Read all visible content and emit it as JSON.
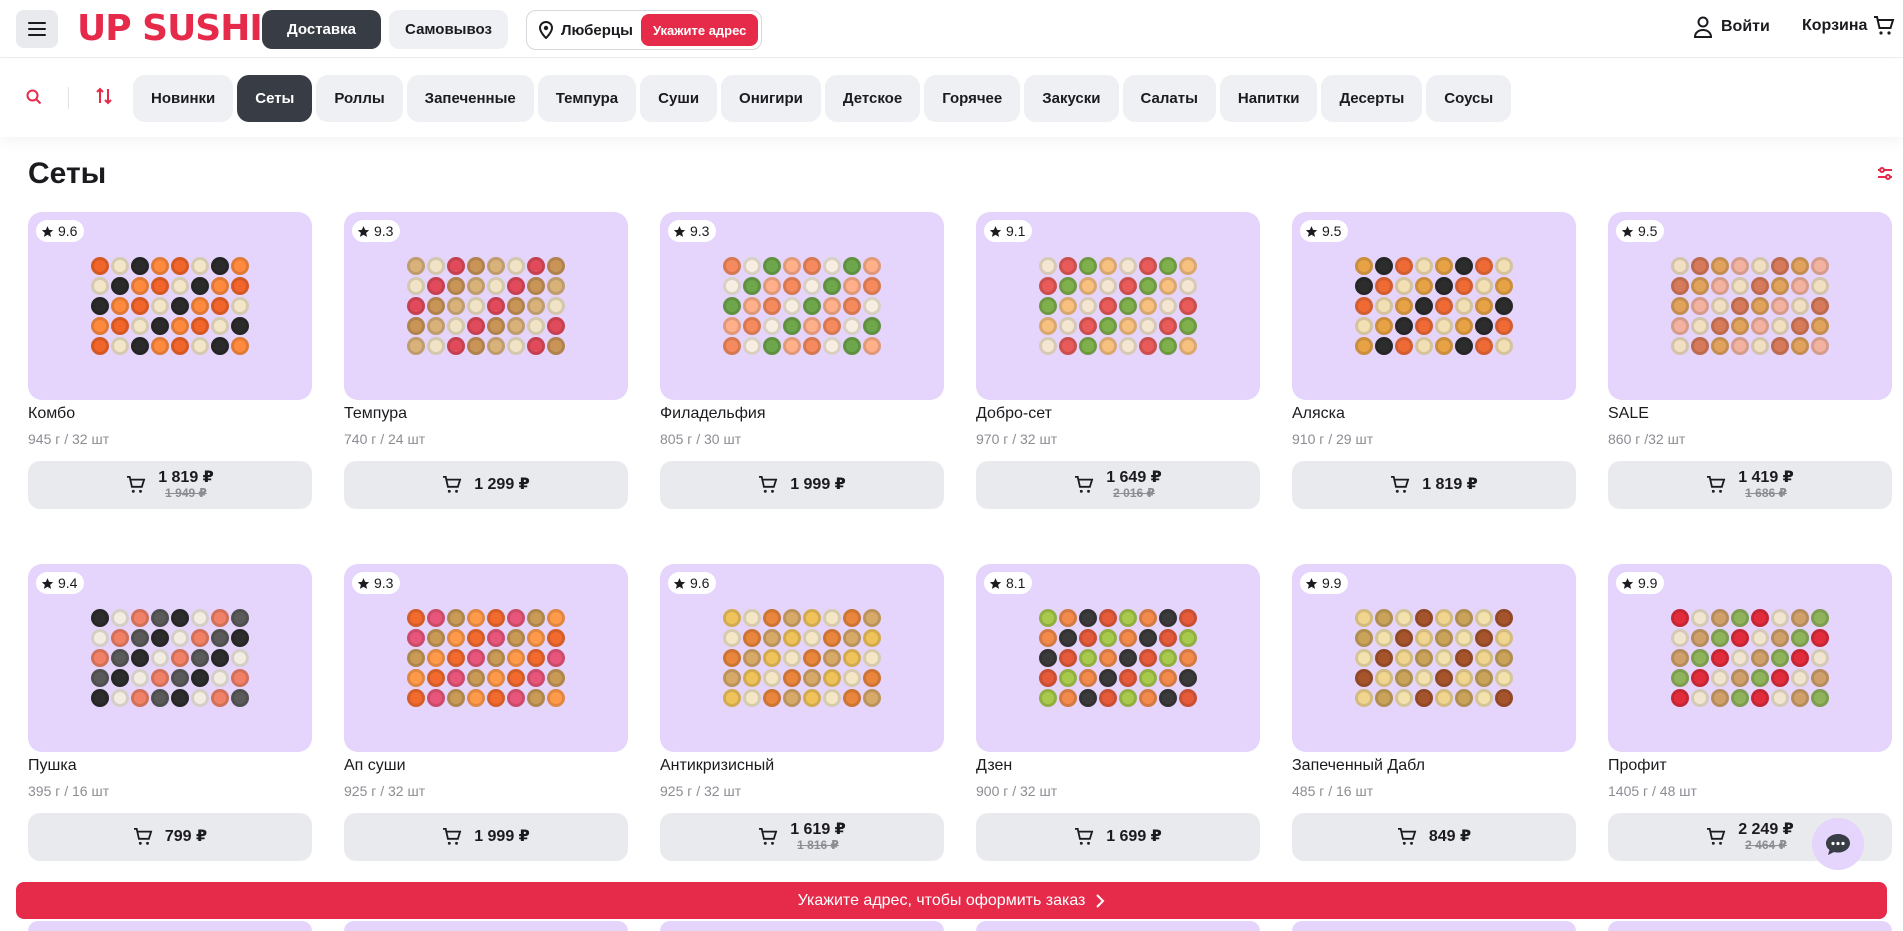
{
  "header": {
    "logo": "UP SUSHI",
    "modes": [
      "Доставка",
      "Самовывоз"
    ],
    "city": "Люберцы",
    "address_button": "Укажите адрес",
    "login": "Войти",
    "cart": "Корзина"
  },
  "categories": [
    "Новинки",
    "Сеты",
    "Роллы",
    "Запеченные",
    "Темпура",
    "Суши",
    "Онигири",
    "Детское",
    "Горячее",
    "Закуски",
    "Салаты",
    "Напитки",
    "Десерты",
    "Соусы"
  ],
  "active_category": "Сеты",
  "page_title": "Сеты",
  "products": [
    {
      "name": "Комбо",
      "rating": "9.6",
      "meta": "945 г / 32 шт",
      "price": "1 819 ₽",
      "old_price": "1 949 ₽",
      "palette": [
        "#f2652a",
        "#f3e6c8",
        "#2b2b2b",
        "#ff8a3d"
      ]
    },
    {
      "name": "Темпура",
      "rating": "9.3",
      "meta": "740 г / 24 шт",
      "price": "1 299 ₽",
      "old_price": "",
      "palette": [
        "#d9b27a",
        "#f1e3c5",
        "#e14a5a",
        "#c99557"
      ]
    },
    {
      "name": "Филадельфия",
      "rating": "9.3",
      "meta": "805 г / 30 шт",
      "price": "1 999 ₽",
      "old_price": "",
      "palette": [
        "#f48a5d",
        "#f7ede0",
        "#6ea64b",
        "#ffb08a"
      ]
    },
    {
      "name": "Добро-сет",
      "rating": "9.1",
      "meta": "970 г / 32 шт",
      "price": "1 649 ₽",
      "old_price": "2 016 ₽",
      "palette": [
        "#f4e6d0",
        "#e85b58",
        "#7fb04c",
        "#f8c07e"
      ]
    },
    {
      "name": "Аляска",
      "rating": "9.5",
      "meta": "910 г / 29 шт",
      "price": "1 819 ₽",
      "old_price": "",
      "palette": [
        "#e8a246",
        "#2c2c2c",
        "#f06a36",
        "#f2dfb3"
      ]
    },
    {
      "name": "SALE",
      "rating": "9.5",
      "meta": "860 г /32 шт",
      "price": "1 419 ₽",
      "old_price": "1 686 ₽",
      "palette": [
        "#f1dfc2",
        "#d67a5a",
        "#e0a25c",
        "#f3b2a0"
      ]
    },
    {
      "name": "Пушка",
      "rating": "9.4",
      "meta": "395 г / 16 шт",
      "price": "799 ₽",
      "old_price": "",
      "palette": [
        "#2d2d2d",
        "#f2ece2",
        "#f08066",
        "#5a5a5a"
      ]
    },
    {
      "name": "Ап суши",
      "rating": "9.3",
      "meta": "925 г / 32 шт",
      "price": "1 999 ₽",
      "old_price": "",
      "palette": [
        "#f26a2e",
        "#e7567a",
        "#c89a55",
        "#ff9a4a"
      ]
    },
    {
      "name": "Антикризисный",
      "rating": "9.6",
      "meta": "925 г / 32 шт",
      "price": "1 619 ₽",
      "old_price": "1 816 ₽",
      "palette": [
        "#f0c35a",
        "#f5e7c6",
        "#e9863c",
        "#d6a968"
      ]
    },
    {
      "name": "Дзен",
      "rating": "8.1",
      "meta": "900 г / 32 шт",
      "price": "1 699 ₽",
      "old_price": "",
      "palette": [
        "#a7c94c",
        "#f28a4c",
        "#3a3a3a",
        "#e45a3a"
      ]
    },
    {
      "name": "Запеченный Дабл",
      "rating": "9.9",
      "meta": "485 г / 16 шт",
      "price": "849 ₽",
      "old_price": "",
      "palette": [
        "#efd58f",
        "#c9a35a",
        "#f3e2ad",
        "#a5542c"
      ]
    },
    {
      "name": "Профит",
      "rating": "9.9",
      "meta": "1405 г / 48 шт",
      "price": "2 249 ₽",
      "old_price": "2 464 ₽",
      "palette": [
        "#e22c3c",
        "#f2e5cf",
        "#d0a06a",
        "#8fb35a"
      ]
    }
  ],
  "banner": "Укажите адрес, чтобы оформить заказ",
  "colors": {
    "brand": "#e62a4a",
    "dark": "#383c44",
    "card_bg": "#e5d4fb"
  }
}
